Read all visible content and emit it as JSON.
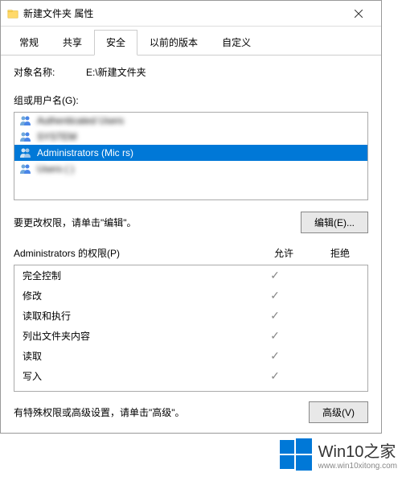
{
  "titlebar": {
    "title": "新建文件夹 属性"
  },
  "tabs": {
    "items": [
      {
        "label": "常规"
      },
      {
        "label": "共享"
      },
      {
        "label": "安全"
      },
      {
        "label": "以前的版本"
      },
      {
        "label": "自定义"
      }
    ],
    "active_index": 2
  },
  "object": {
    "label": "对象名称:",
    "value": "E:\\新建文件夹"
  },
  "groups": {
    "label": "组或用户名(G):",
    "items": [
      {
        "text": "Authenticated Users",
        "blurred": true
      },
      {
        "text": "SYSTEM",
        "blurred": true
      },
      {
        "text": "Administrators (Mic                                                   rs)",
        "blurred": false,
        "selected": true
      },
      {
        "text": "Users (                                   )",
        "blurred": true
      }
    ]
  },
  "edit": {
    "hint": "要更改权限，请单击\"编辑\"。",
    "button": "编辑(E)..."
  },
  "permissions": {
    "header": "Administrators 的权限(P)",
    "col_allow": "允许",
    "col_deny": "拒绝",
    "rows": [
      {
        "name": "完全控制",
        "allow": true,
        "deny": false
      },
      {
        "name": "修改",
        "allow": true,
        "deny": false
      },
      {
        "name": "读取和执行",
        "allow": true,
        "deny": false
      },
      {
        "name": "列出文件夹内容",
        "allow": true,
        "deny": false
      },
      {
        "name": "读取",
        "allow": true,
        "deny": false
      },
      {
        "name": "写入",
        "allow": true,
        "deny": false
      }
    ]
  },
  "advanced": {
    "hint": "有特殊权限或高级设置，请单击\"高级\"。",
    "button": "高级(V)"
  },
  "watermark": {
    "title": "Win10之家",
    "url": "www.win10xitong.com"
  },
  "colors": {
    "selection": "#0078d7",
    "win_blue": "#0078d7"
  }
}
